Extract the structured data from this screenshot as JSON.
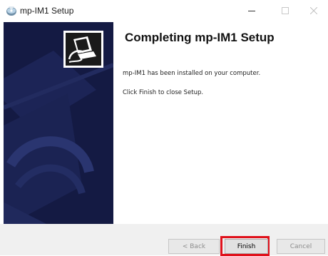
{
  "window": {
    "title": "mp-IM1 Setup",
    "icons": {
      "app": "setup-disc-icon",
      "minimize": "minimize-icon",
      "maximize": "maximize-icon",
      "close": "close-icon"
    }
  },
  "sidebar": {
    "graphic": "installer-computer-logo"
  },
  "content": {
    "heading": "Completing mp-IM1 Setup",
    "installed_message": "mp-IM1 has been installed on your computer.",
    "instruction": "Click Finish to close Setup."
  },
  "footer": {
    "back_label": "< Back",
    "finish_label": "Finish",
    "cancel_label": "Cancel",
    "highlight_color": "#e0111b"
  },
  "colors": {
    "sidebar_bg": "#141a43",
    "footer_bg": "#f0f0f0"
  }
}
